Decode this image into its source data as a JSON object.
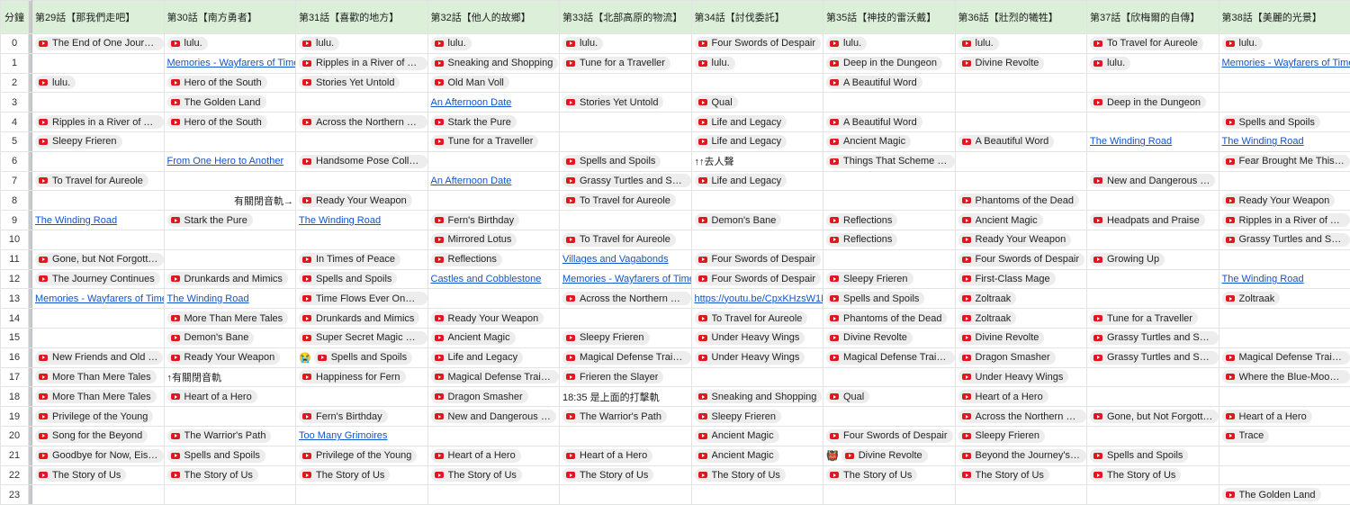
{
  "header": {
    "corner": "分鐘",
    "columns": [
      "第29話【那我們走吧】",
      "第30話【南方勇者】",
      "第31話【喜歡的地方】",
      "第32話【他人的故鄉】",
      "第33話【北部高原的物流】",
      "第34話【討伐委託】",
      "第35話【神技的雷沃戴】",
      "第36話【壯烈的犧牲】",
      "第37話【欣梅爾的自傳】",
      "第38話【美麗的光景】"
    ]
  },
  "rows": [
    {
      "minute": "0",
      "cells": [
        {
          "t": "chip",
          "v": "The End of One Journey"
        },
        {
          "t": "chip",
          "v": "lulu."
        },
        {
          "t": "chip",
          "v": "lulu."
        },
        {
          "t": "chip",
          "v": "lulu."
        },
        {
          "t": "chip",
          "v": "lulu."
        },
        {
          "t": "chip",
          "v": "Four Swords of Despair"
        },
        {
          "t": "chip",
          "v": "lulu."
        },
        {
          "t": "chip",
          "v": "lulu."
        },
        {
          "t": "chip",
          "v": "To Travel for Aureole"
        },
        {
          "t": "chip",
          "v": "lulu."
        }
      ]
    },
    {
      "minute": "1",
      "cells": [
        null,
        {
          "t": "link",
          "v": "Memories - Wayfarers of Time"
        },
        {
          "t": "chip",
          "v": "Ripples in a River of Ti…"
        },
        {
          "t": "chip",
          "v": "Sneaking and Shopping"
        },
        {
          "t": "chip",
          "v": "Tune for a Traveller"
        },
        {
          "t": "chip",
          "v": "lulu."
        },
        {
          "t": "chip",
          "v": "Deep in the Dungeon"
        },
        {
          "t": "chip",
          "v": "Divine Revolte"
        },
        {
          "t": "chip",
          "v": "lulu."
        },
        {
          "t": "link",
          "v": "Memories - Wayfarers of Time"
        }
      ]
    },
    {
      "minute": "2",
      "cells": [
        {
          "t": "chip",
          "v": "lulu."
        },
        {
          "t": "chip",
          "v": "Hero of the South"
        },
        {
          "t": "chip",
          "v": "Stories Yet Untold"
        },
        {
          "t": "chip",
          "v": "Old Man Voll"
        },
        null,
        null,
        {
          "t": "chip",
          "v": "A Beautiful Word"
        },
        null,
        null,
        null
      ]
    },
    {
      "minute": "3",
      "cells": [
        null,
        {
          "t": "chip",
          "v": "The Golden Land"
        },
        null,
        {
          "t": "link",
          "v": "An Afternoon Date"
        },
        {
          "t": "chip",
          "v": "Stories Yet Untold"
        },
        {
          "t": "chip",
          "v": "Qual"
        },
        null,
        null,
        {
          "t": "chip",
          "v": "Deep in the Dungeon"
        },
        null
      ]
    },
    {
      "minute": "4",
      "cells": [
        {
          "t": "chip",
          "v": "Ripples in a River of Ti…"
        },
        {
          "t": "chip",
          "v": "Hero of the South"
        },
        {
          "t": "chip",
          "v": "Across the Northern L…"
        },
        {
          "t": "chip",
          "v": "Stark the Pure"
        },
        null,
        {
          "t": "chip",
          "v": "Life and Legacy"
        },
        {
          "t": "chip",
          "v": "A Beautiful Word"
        },
        null,
        null,
        {
          "t": "chip",
          "v": "Spells and Spoils"
        }
      ]
    },
    {
      "minute": "5",
      "cells": [
        {
          "t": "chip",
          "v": "Sleepy Frieren"
        },
        null,
        null,
        {
          "t": "chip",
          "v": "Tune for a Traveller"
        },
        null,
        {
          "t": "chip",
          "v": "Life and Legacy"
        },
        {
          "t": "chip",
          "v": "Ancient Magic"
        },
        {
          "t": "chip",
          "v": "A Beautiful Word"
        },
        {
          "t": "link",
          "v": "The Winding Road"
        },
        {
          "t": "link",
          "v": "The Winding Road"
        }
      ]
    },
    {
      "minute": "6",
      "cells": [
        null,
        {
          "t": "link",
          "v": "From One Hero to Another"
        },
        {
          "t": "chip",
          "v": "Handsome Pose Colle…"
        },
        null,
        {
          "t": "chip",
          "v": "Spells and Spoils"
        },
        {
          "t": "plain",
          "v": "↑↑去人聲"
        },
        {
          "t": "chip",
          "v": "Things That Scheme i…"
        },
        null,
        null,
        {
          "t": "chip",
          "v": "Fear Brought Me This …"
        }
      ]
    },
    {
      "minute": "7",
      "cells": [
        {
          "t": "chip",
          "v": "To Travel for Aureole"
        },
        null,
        null,
        {
          "t": "link",
          "v": "An Afternoon Date"
        },
        {
          "t": "chip",
          "v": "Grassy Turtles and Se…"
        },
        {
          "t": "chip",
          "v": "Life and Legacy"
        },
        null,
        null,
        {
          "t": "chip",
          "v": "New and Dangerous …"
        },
        null
      ]
    },
    {
      "minute": "8",
      "cells": [
        null,
        {
          "t": "right",
          "v": "有關閉音軌→"
        },
        {
          "t": "chip",
          "v": "Ready Your Weapon"
        },
        null,
        {
          "t": "chip",
          "v": "To Travel for Aureole"
        },
        null,
        null,
        {
          "t": "chip",
          "v": "Phantoms of the Dead"
        },
        null,
        {
          "t": "chip",
          "v": "Ready Your Weapon"
        }
      ]
    },
    {
      "minute": "9",
      "cells": [
        {
          "t": "link",
          "v": "The Winding Road"
        },
        {
          "t": "chip",
          "v": "Stark the Pure"
        },
        {
          "t": "link",
          "v": "The Winding Road"
        },
        {
          "t": "chip",
          "v": "Fern's Birthday"
        },
        null,
        {
          "t": "chip",
          "v": "Demon's Bane"
        },
        {
          "t": "chip",
          "v": "Reflections"
        },
        {
          "t": "chip",
          "v": "Ancient Magic"
        },
        {
          "t": "chip",
          "v": "Headpats and Praise"
        },
        {
          "t": "chip",
          "v": "Ripples in a River of Ti…"
        }
      ]
    },
    {
      "minute": "10",
      "cells": [
        null,
        null,
        null,
        {
          "t": "chip",
          "v": "Mirrored Lotus"
        },
        {
          "t": "chip",
          "v": "To Travel for Aureole"
        },
        null,
        {
          "t": "chip",
          "v": "Reflections"
        },
        {
          "t": "chip",
          "v": "Ready Your Weapon"
        },
        null,
        {
          "t": "chip",
          "v": "Grassy Turtles and Se…"
        }
      ]
    },
    {
      "minute": "11",
      "cells": [
        {
          "t": "chip",
          "v": "Gone, but Not Forgotten"
        },
        null,
        {
          "t": "chip",
          "v": "In Times of Peace"
        },
        {
          "t": "chip",
          "v": "Reflections"
        },
        {
          "t": "link",
          "v": "Villages and Vagabonds"
        },
        {
          "t": "chip",
          "v": "Four Swords of Despair"
        },
        null,
        {
          "t": "chip",
          "v": "Four Swords of Despair"
        },
        {
          "t": "chip",
          "v": "Growing Up"
        },
        null
      ]
    },
    {
      "minute": "12",
      "cells": [
        {
          "t": "chip",
          "v": "The Journey Continues"
        },
        {
          "t": "chip",
          "v": "Drunkards and Mimics"
        },
        {
          "t": "chip",
          "v": "Spells and Spoils"
        },
        {
          "t": "link",
          "v": "Castles and Cobblestone"
        },
        {
          "t": "link",
          "v": "Memories - Wayfarers of Time"
        },
        {
          "t": "chip",
          "v": "Four Swords of Despair"
        },
        {
          "t": "chip",
          "v": "Sleepy Frieren"
        },
        {
          "t": "chip",
          "v": "First-Class Mage"
        },
        null,
        {
          "t": "link",
          "v": "The Winding Road"
        }
      ]
    },
    {
      "minute": "13",
      "cells": [
        {
          "t": "link",
          "v": "Memories - Wayfarers of Time"
        },
        {
          "t": "link",
          "v": "The Winding Road"
        },
        {
          "t": "chip",
          "v": "Time Flows Ever Onw…"
        },
        null,
        {
          "t": "chip",
          "v": "Across the Northern L…"
        },
        {
          "t": "link",
          "v": "https://youtu.be/CpxKHzsW1N"
        },
        {
          "t": "chip",
          "v": "Spells and Spoils"
        },
        {
          "t": "chip",
          "v": "Zoltraak"
        },
        null,
        {
          "t": "chip",
          "v": "Zoltraak"
        }
      ]
    },
    {
      "minute": "14",
      "cells": [
        null,
        {
          "t": "chip",
          "v": "More Than Mere Tales"
        },
        {
          "t": "chip",
          "v": "Drunkards and Mimics"
        },
        {
          "t": "chip",
          "v": "Ready Your Weapon"
        },
        null,
        {
          "t": "chip",
          "v": "To Travel for Aureole"
        },
        {
          "t": "chip",
          "v": "Phantoms of the Dead"
        },
        {
          "t": "chip",
          "v": "Zoltraak"
        },
        {
          "t": "chip",
          "v": "Tune for a Traveller"
        },
        null
      ]
    },
    {
      "minute": "15",
      "cells": [
        null,
        {
          "t": "chip",
          "v": "Demon's Bane"
        },
        {
          "t": "chip",
          "v": "Super Secret Magic P…"
        },
        {
          "t": "chip",
          "v": "Ancient Magic"
        },
        {
          "t": "chip",
          "v": "Sleepy Frieren"
        },
        {
          "t": "chip",
          "v": "Under Heavy Wings"
        },
        {
          "t": "chip",
          "v": "Divine Revolte"
        },
        {
          "t": "chip",
          "v": "Divine Revolte"
        },
        {
          "t": "chip",
          "v": "Grassy Turtles and Se…"
        },
        null
      ]
    },
    {
      "minute": "16",
      "cells": [
        {
          "t": "chip",
          "v": "New Friends and Old …"
        },
        {
          "t": "chip",
          "v": "Ready Your Weapon"
        },
        {
          "t": "emojichip",
          "e": "😭",
          "v": "Spells and Spoils"
        },
        {
          "t": "chip",
          "v": "Life and Legacy"
        },
        {
          "t": "chip",
          "v": "Magical Defense Train…"
        },
        {
          "t": "chip",
          "v": "Under Heavy Wings"
        },
        {
          "t": "chip",
          "v": "Magical Defense Train…"
        },
        {
          "t": "chip",
          "v": "Dragon Smasher"
        },
        {
          "t": "chip",
          "v": "Grassy Turtles and Se…"
        },
        {
          "t": "chip",
          "v": "Magical Defense Train…"
        }
      ]
    },
    {
      "minute": "17",
      "cells": [
        {
          "t": "chip",
          "v": "More Than Mere Tales"
        },
        {
          "t": "plain",
          "v": "↑有關閉音軌"
        },
        {
          "t": "chip",
          "v": "Happiness for Fern"
        },
        {
          "t": "chip",
          "v": "Magical Defense Train…"
        },
        {
          "t": "chip",
          "v": "Frieren the Slayer"
        },
        null,
        null,
        {
          "t": "chip",
          "v": "Under Heavy Wings"
        },
        null,
        {
          "t": "chip",
          "v": "Where the Blue-Moon …"
        }
      ]
    },
    {
      "minute": "18",
      "cells": [
        {
          "t": "chip",
          "v": "More Than Mere Tales"
        },
        {
          "t": "chip",
          "v": "Heart of a Hero"
        },
        null,
        {
          "t": "chip",
          "v": "Dragon Smasher"
        },
        {
          "t": "plain",
          "v": "18:35 是上面的打擊軌"
        },
        {
          "t": "chip",
          "v": "Sneaking and Shopping"
        },
        {
          "t": "chip",
          "v": "Qual"
        },
        {
          "t": "chip",
          "v": "Heart of a Hero"
        },
        null,
        null
      ]
    },
    {
      "minute": "19",
      "cells": [
        {
          "t": "chip",
          "v": "Privilege of the Young"
        },
        null,
        {
          "t": "chip",
          "v": "Fern's Birthday"
        },
        {
          "t": "chip",
          "v": "New and Dangerous …"
        },
        {
          "t": "chip",
          "v": "The Warrior's Path"
        },
        {
          "t": "chip",
          "v": "Sleepy Frieren"
        },
        null,
        {
          "t": "chip",
          "v": "Across the Northern L…"
        },
        {
          "t": "chip",
          "v": "Gone, but Not Forgotten"
        },
        {
          "t": "chip",
          "v": "Heart of a Hero"
        }
      ]
    },
    {
      "minute": "20",
      "cells": [
        {
          "t": "chip",
          "v": "Song for the Beyond"
        },
        {
          "t": "chip",
          "v": "The Warrior's Path"
        },
        {
          "t": "link",
          "v": "Too Many Grimoires"
        },
        null,
        null,
        {
          "t": "chip",
          "v": "Ancient Magic"
        },
        {
          "t": "chip",
          "v": "Four Swords of Despair"
        },
        {
          "t": "chip",
          "v": "Sleepy Frieren"
        },
        null,
        {
          "t": "chip",
          "v": "Trace"
        }
      ]
    },
    {
      "minute": "21",
      "cells": [
        {
          "t": "chip",
          "v": "Goodbye for Now, Eisen"
        },
        {
          "t": "chip",
          "v": "Spells and Spoils"
        },
        {
          "t": "chip",
          "v": "Privilege of the Young"
        },
        {
          "t": "chip",
          "v": "Heart of a Hero"
        },
        {
          "t": "chip",
          "v": "Heart of a Hero"
        },
        {
          "t": "chip",
          "v": "Ancient Magic"
        },
        {
          "t": "emojichip",
          "e": "👹",
          "v": "Divine Revolte"
        },
        {
          "t": "chip",
          "v": "Beyond the Journey's …"
        },
        {
          "t": "chip",
          "v": "Spells and Spoils"
        },
        null
      ]
    },
    {
      "minute": "22",
      "cells": [
        {
          "t": "chip",
          "v": "The Story of Us"
        },
        {
          "t": "chip",
          "v": "The Story of Us"
        },
        {
          "t": "chip",
          "v": "The Story of Us"
        },
        {
          "t": "chip",
          "v": "The Story of Us"
        },
        {
          "t": "chip",
          "v": "The Story of Us"
        },
        {
          "t": "chip",
          "v": "The Story of Us"
        },
        {
          "t": "chip",
          "v": "The Story of Us"
        },
        {
          "t": "chip",
          "v": "The Story of Us"
        },
        {
          "t": "chip",
          "v": "The Story of Us"
        },
        null
      ]
    },
    {
      "minute": "23",
      "cells": [
        null,
        null,
        null,
        null,
        null,
        null,
        null,
        null,
        null,
        {
          "t": "chip",
          "v": "The Golden Land"
        }
      ]
    }
  ]
}
